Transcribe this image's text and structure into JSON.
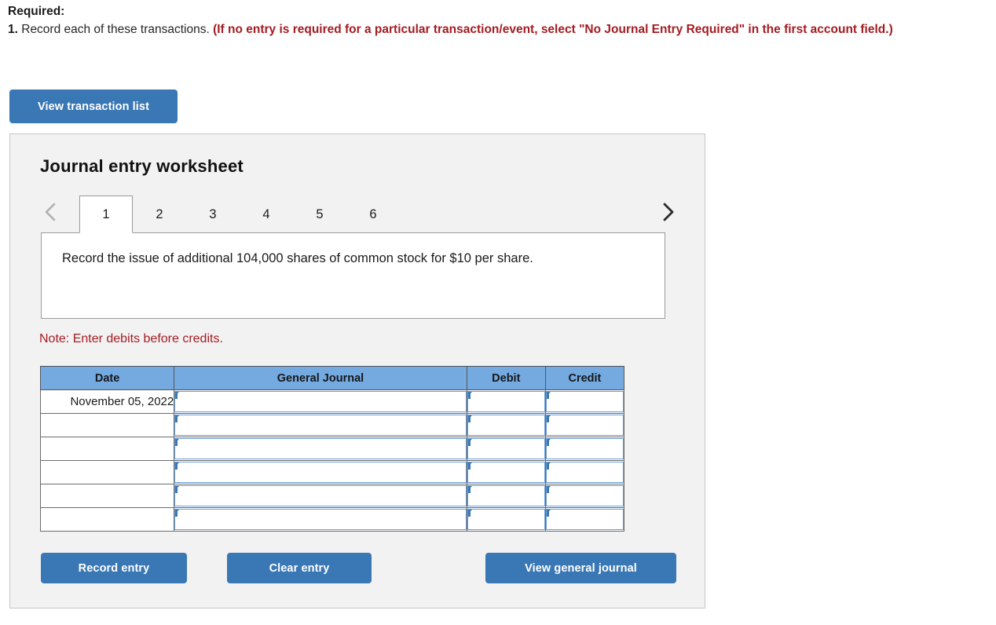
{
  "instructions": {
    "required_label": "Required:",
    "item_number": "1.",
    "item_text": " Record each of these transactions. ",
    "item_emphasis": "(If no entry is required for a particular transaction/event, select \"No Journal Entry Required\" in the first account field.)"
  },
  "toolbar": {
    "view_transaction_list_label": "View transaction list"
  },
  "worksheet": {
    "title": "Journal entry worksheet",
    "prev_icon": "chevron-left-icon",
    "next_icon": "chevron-right-icon",
    "tabs": [
      {
        "label": "1",
        "active": true
      },
      {
        "label": "2",
        "active": false
      },
      {
        "label": "3",
        "active": false
      },
      {
        "label": "4",
        "active": false
      },
      {
        "label": "5",
        "active": false
      },
      {
        "label": "6",
        "active": false
      }
    ],
    "description": "Record the issue of additional 104,000 shares of common stock for $10 per share.",
    "note": "Note: Enter debits before credits."
  },
  "table": {
    "headers": {
      "date": "Date",
      "general_journal": "General Journal",
      "debit": "Debit",
      "credit": "Credit"
    },
    "rows": [
      {
        "date": "November 05, 2022",
        "account": "",
        "debit": "",
        "credit": ""
      },
      {
        "date": "",
        "account": "",
        "debit": "",
        "credit": ""
      },
      {
        "date": "",
        "account": "",
        "debit": "",
        "credit": ""
      },
      {
        "date": "",
        "account": "",
        "debit": "",
        "credit": ""
      },
      {
        "date": "",
        "account": "",
        "debit": "",
        "credit": ""
      },
      {
        "date": "",
        "account": "",
        "debit": "",
        "credit": ""
      }
    ]
  },
  "actions": {
    "record_entry_label": "Record entry",
    "clear_entry_label": "Clear entry",
    "view_general_journal_label": "View general journal"
  },
  "colors": {
    "button_blue": "#3a78b5",
    "table_header_blue": "#74aae0",
    "alert_red": "#a41c22",
    "panel_gray": "#f2f2f2"
  }
}
